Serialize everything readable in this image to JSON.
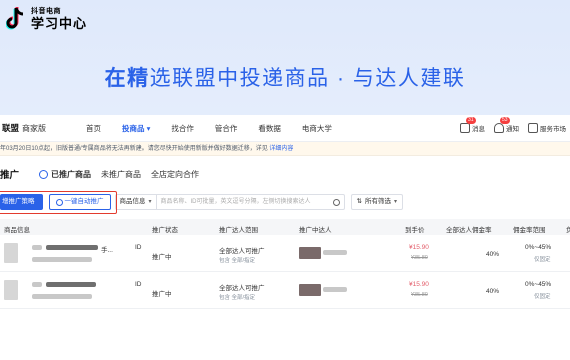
{
  "logo": {
    "small": "抖音电商",
    "big": "学习中心"
  },
  "banner": {
    "bold": "在精",
    "rest": "选联盟中投递商品 · 与达人建联"
  },
  "app": {
    "brand": "联盟",
    "brand_sub": "商家版",
    "nav": [
      "首页",
      "投商品",
      "找合作",
      "管合作",
      "看数据",
      "电商大学"
    ],
    "nav_active_index": 1,
    "right": [
      {
        "label": "消息",
        "badge": "31"
      },
      {
        "label": "通知",
        "badge": "53"
      },
      {
        "label": "服务市场",
        "badge": ""
      }
    ]
  },
  "notice": {
    "text": "年03月20日10点起，旧版普通/专属商品将无法再新建。请您尽快开始使用新版并做好数据迁移，详见",
    "link": "详细内容"
  },
  "page": {
    "title": "推广",
    "tabs": [
      "已推广商品",
      "未推广商品",
      "全店定向合作"
    ],
    "active_tab": 0
  },
  "toolbar": {
    "primary": "增推广策略",
    "outline": "一键自动推广",
    "select": "商品信息",
    "search_placeholder": "商品名称、ID可批量，英文逗号分隔，左侧切换搜索达人",
    "filter": "所有筛选"
  },
  "table": {
    "headers": [
      "商品信息",
      "推广状态",
      "推广达人范围",
      "推广中达人",
      "到手价",
      "全部达人佣金率",
      "佣金率范围",
      "负"
    ],
    "rows": [
      {
        "name_suffix": "手...",
        "id_label": "ID",
        "status": "推广中",
        "scope_line1": "全部达人可推广",
        "scope_line2": "包含 全部/指定",
        "price": "¥15.90",
        "orig_price": "¥35.80",
        "rate": "40%",
        "range": "0%~45%",
        "range_sub": "仅固定"
      },
      {
        "name_suffix": "",
        "id_label": "ID",
        "status": "推广中",
        "scope_line1": "全部达人可推广",
        "scope_line2": "包含 全部/指定",
        "price": "¥15.90",
        "orig_price": "¥35.80",
        "rate": "40%",
        "range": "0%~45%",
        "range_sub": "仅固定"
      }
    ]
  },
  "colors": {
    "accent": "#2a62e8",
    "highlight": "#e33b2e",
    "price": "#e35d6a"
  }
}
